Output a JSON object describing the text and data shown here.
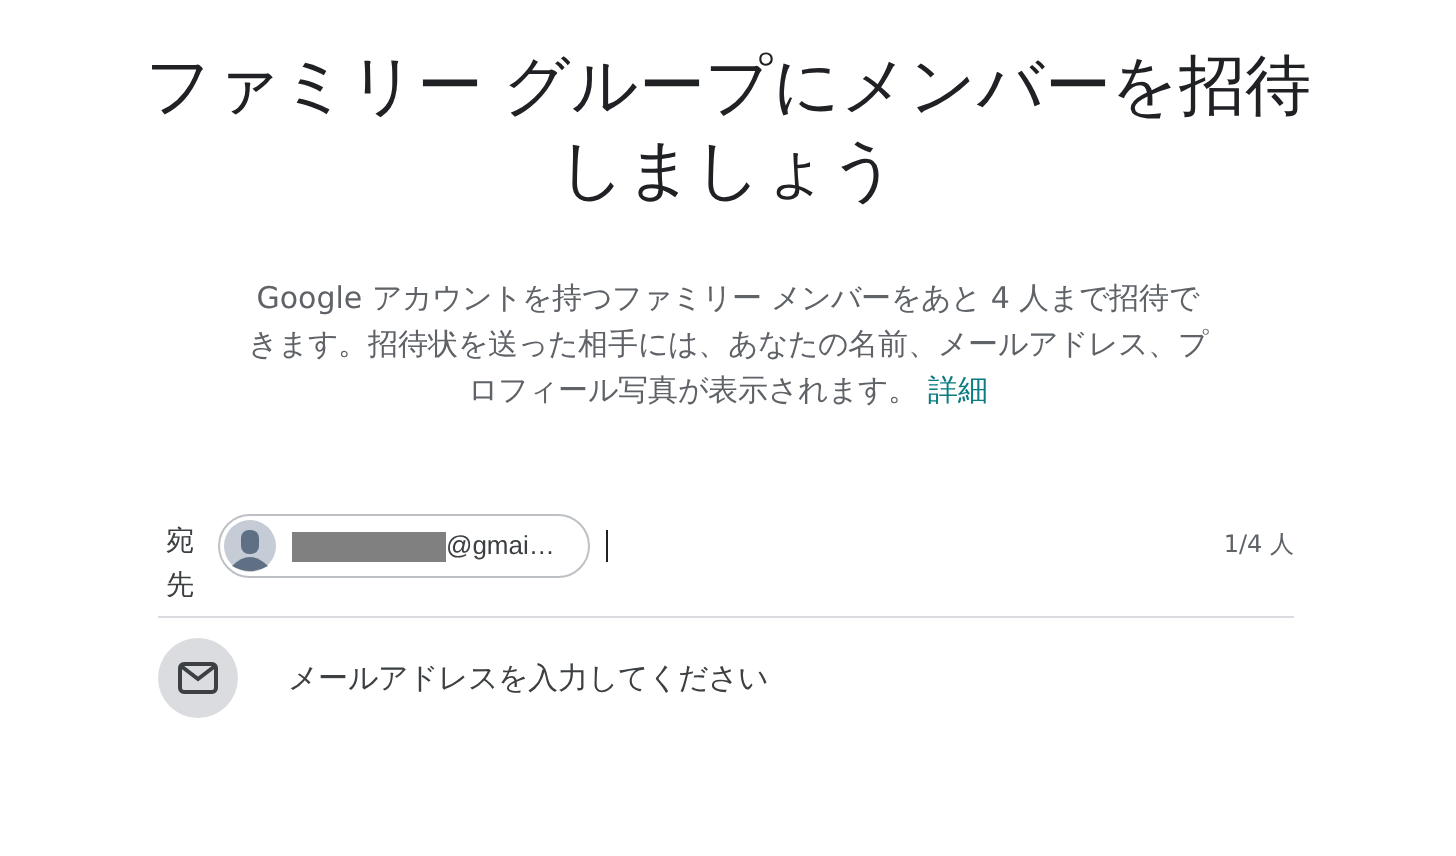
{
  "title": "ファミリー グループにメンバーを招待しましょう",
  "description": {
    "text": "Google アカウントを持つファミリー メンバーをあと 4 人まで招待できます。招待状を送った相手には、あなたの名前、メールアドレス、プロフィール写真が表示されます。",
    "link": "詳細"
  },
  "recipients": {
    "label": "宛先",
    "chips": [
      {
        "email": "@gmai…"
      }
    ],
    "counter": "1/4 人"
  },
  "suggestion": {
    "placeholder": "メールアドレスを入力してください"
  }
}
